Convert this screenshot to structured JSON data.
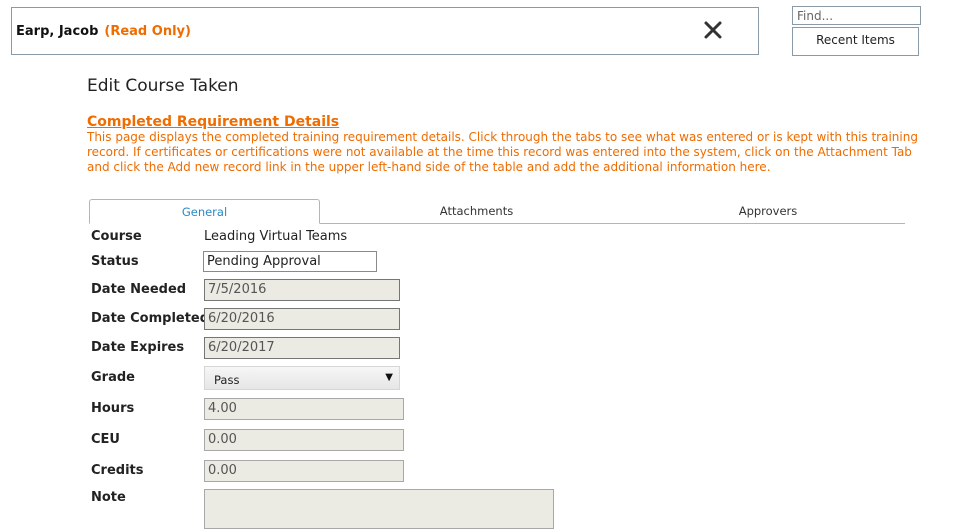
{
  "header": {
    "person_name": "Earp, Jacob",
    "readonly_label": "(Read Only)",
    "close_icon": "close-icon"
  },
  "search": {
    "placeholder": "Find...",
    "value": ""
  },
  "recent_items_label": "Recent Items",
  "page": {
    "title": "Edit Course Taken",
    "section_link": "Completed Requirement Details",
    "description": "This page displays the completed training requirement details.  Click through the tabs to see what was entered or is kept with this training record.  If certificates or certifications were not available at the time this record was entered into the system, click on the Attachment Tab and click the Add new record link in the upper left-hand side of the table and add the additional information here."
  },
  "tabs": [
    {
      "label": "General",
      "active": true
    },
    {
      "label": "Attachments",
      "active": false
    },
    {
      "label": "Approvers",
      "active": false
    }
  ],
  "form": {
    "course": {
      "label": "Course",
      "value": "Leading Virtual Teams"
    },
    "status": {
      "label": "Status",
      "value": "Pending Approval"
    },
    "date_needed": {
      "label": "Date Needed",
      "value": "7/5/2016"
    },
    "date_completed": {
      "label": "Date Completed",
      "value": "6/20/2016"
    },
    "date_expires": {
      "label": "Date Expires",
      "value": "6/20/2017"
    },
    "grade": {
      "label": "Grade",
      "value": "Pass"
    },
    "hours": {
      "label": "Hours",
      "value": "4.00"
    },
    "ceu": {
      "label": "CEU",
      "value": "0.00"
    },
    "credits": {
      "label": "Credits",
      "value": "0.00"
    },
    "note": {
      "label": "Note",
      "value": ""
    }
  },
  "colors": {
    "accent": "#ef6c00",
    "tab_active": "#2b8ac6",
    "readonly_bg": "#ebebe4"
  }
}
